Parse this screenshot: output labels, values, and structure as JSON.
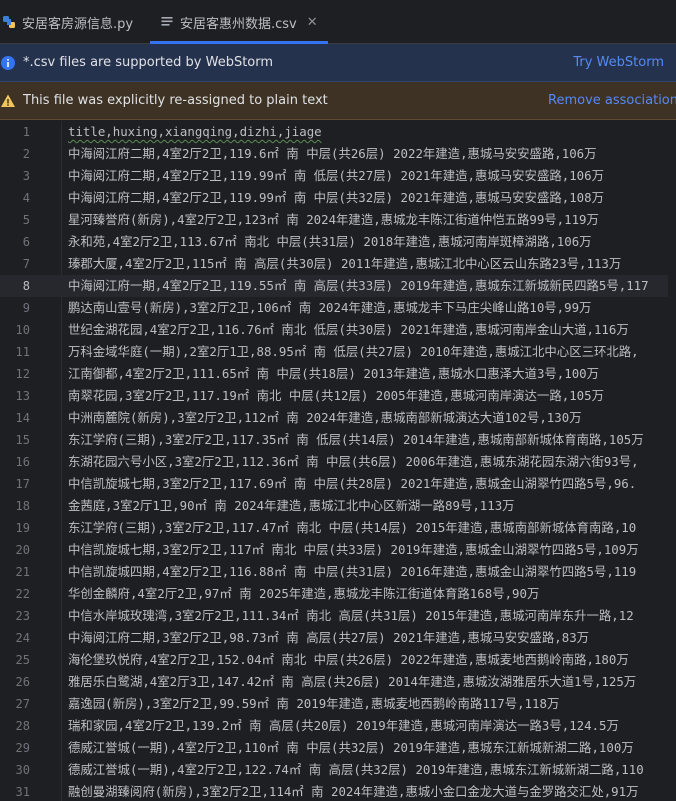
{
  "tabs": [
    {
      "label": "安居客房源信息.py",
      "icon": "python-file-icon"
    },
    {
      "label": "安居客惠州数据.csv",
      "icon": "text-file-icon"
    }
  ],
  "banners": {
    "webstorm": {
      "text": "*.csv files are supported by WebStorm",
      "link": "Try WebStorm",
      "icon": "info-icon",
      "color": "#3574f0"
    },
    "plain_text": {
      "text": "This file was explicitly re-assigned to plain text",
      "link": "Remove association",
      "icon": "warning-icon",
      "color": "#f2c55c"
    }
  },
  "editor": {
    "current_line": 8,
    "lines": [
      "title,huxing,xiangqing,dizhi,jiage",
      "中海阅江府二期,4室2厅2卫,119.6㎡ 南 中层(共26层) 2022年建造,惠城马安安盛路,106万",
      "中海阅江府二期,4室2厅2卫,119.99㎡ 南 低层(共27层) 2021年建造,惠城马安安盛路,106万",
      "中海阅江府二期,4室2厅2卫,119.99㎡ 南 中层(共32层) 2021年建造,惠城马安安盛路,108万",
      "星河臻誉府(新房),4室2厅2卫,123㎡ 南 2024年建造,惠城龙丰陈江街道仲恺五路99号,119万",
      "永和苑,4室2厅2卫,113.67㎡ 南北 中层(共31层) 2018年建造,惠城河南岸斑樟湖路,106万",
      "瑧郡大厦,4室2厅2卫,115㎡ 南 高层(共30层) 2011年建造,惠城江北中心区云山东路23号,113万",
      "中海阅江府一期,4室2厅2卫,119.55㎡ 南 高层(共33层) 2019年建造,惠城东江新城新民四路5号,117",
      "鹏达南山壹号(新房),3室2厅2卫,106㎡ 南 2024年建造,惠城龙丰下马庄尖峰山路10号,99万",
      "世纪金湖花园,4室2厅2卫,116.76㎡ 南北 低层(共30层) 2021年建造,惠城河南岸金山大道,116万",
      "万科金域华庭(一期),2室2厅1卫,88.95㎡ 南 低层(共27层) 2010年建造,惠城江北中心区三环北路,",
      "江南御都,4室2厅2卫,111.65㎡ 南 中层(共18层) 2013年建造,惠城水口惠泽大道3号,100万",
      "南翠花园,3室2厅2卫,117.19㎡ 南北 中层(共12层) 2005年建造,惠城河南岸演达一路,105万",
      "中洲南麓院(新房),3室2厅2卫,112㎡ 南 2024年建造,惠城南部新城演达大道102号,130万",
      "东江学府(三期),3室2厅2卫,117.35㎡ 南 低层(共14层) 2014年建造,惠城南部新城体育南路,105万",
      "东湖花园六号小区,3室2厅2卫,112.36㎡ 南 中层(共6层) 2006年建造,惠城东湖花园东湖六街93号,",
      "中信凯旋城七期,3室2厅2卫,117.69㎡ 南 中层(共28层) 2021年建造,惠城金山湖翠竹四路5号,96.",
      "金茜庭,3室2厅1卫,90㎡ 南 2024年建造,惠城江北中心区新湖一路89号,113万",
      "东江学府(三期),3室2厅2卫,117.47㎡ 南北 中层(共14层) 2015年建造,惠城南部新城体育南路,10",
      "中信凯旋城七期,3室2厅2卫,117㎡ 南北 中层(共33层) 2019年建造,惠城金山湖翠竹四路5号,109万",
      "中信凯旋城四期,4室2厅2卫,116.88㎡ 南 中层(共31层) 2016年建造,惠城金山湖翠竹四路5号,119",
      "华创金麟府,4室2厅2卫,97㎡ 南 2025年建造,惠城龙丰陈江街道体育路168号,90万",
      "中信水岸城玫瑰湾,3室2厅2卫,111.34㎡ 南北 高层(共31层) 2015年建造,惠城河南岸东升一路,12",
      "中海阅江府二期,3室2厅2卫,98.73㎡ 南 高层(共27层) 2021年建造,惠城马安安盛路,83万",
      "海伦堡玖悦府,4室2厅2卫,152.04㎡ 南北 中层(共26层) 2022年建造,惠城麦地西鹅岭南路,180万",
      "雅居乐白鹭湖,4室2厅3卫,147.42㎡ 南 高层(共26层) 2014年建造,惠城汝湖雅居乐大道1号,125万",
      "嘉逸园(新房),3室2厅2卫,99.59㎡ 南 2019年建造,惠城麦地西鹅岭南路117号,118万",
      "瑞和家园,4室2厅2卫,139.2㎡ 南 高层(共20层) 2019年建造,惠城河南岸演达一路3号,124.5万",
      "德威江誉城(一期),4室2厅2卫,110㎡ 南 中层(共32层) 2019年建造,惠城东江新城新湖二路,100万",
      "德威江誉城(一期),4室2厅2卫,122.74㎡ 南 高层(共32层) 2019年建造,惠城东江新城新湖二路,110",
      "融创曼湖臻阅府(新房),3室2厅2卫,114㎡ 南 2024年建造,惠城小金口金龙大道与金罗路交汇处,91万"
    ]
  }
}
